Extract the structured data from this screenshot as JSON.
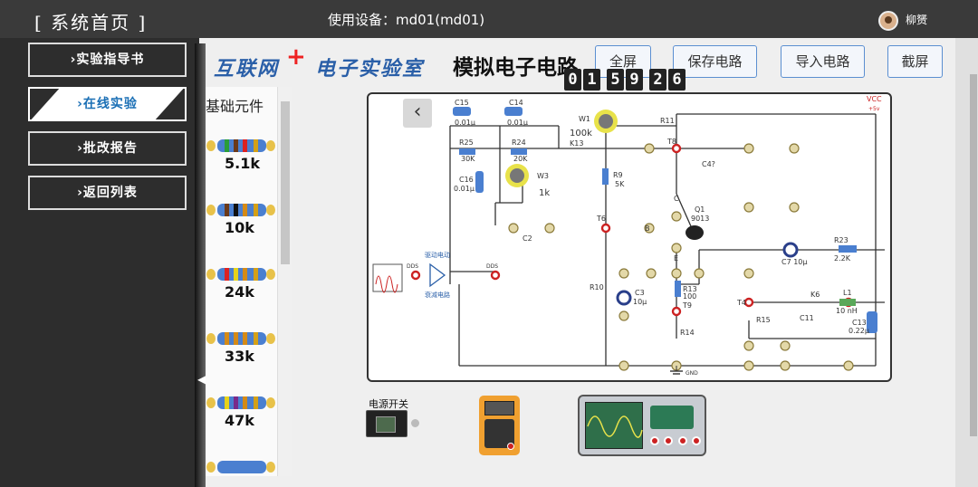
{
  "header": {
    "title": "[ 系统首页 ]",
    "device_label": "使用设备：md01(md01)",
    "username": "柳赟"
  },
  "nav": {
    "items": [
      {
        "label": "›实验指导书"
      },
      {
        "label": "›在线实验"
      },
      {
        "label": "›批改报告"
      },
      {
        "label": "›返回列表"
      }
    ]
  },
  "brand": {
    "part1": "互联网",
    "plus": "+",
    "part2": "电子实验室"
  },
  "circuit_title": "模拟电子电路",
  "toolbar": {
    "fullscreen": "全屏",
    "save": "保存电路",
    "import": "导入电路",
    "screenshot": "截屏"
  },
  "timer": {
    "digits": [
      "0",
      "1",
      "5",
      "9",
      "2",
      "6"
    ]
  },
  "components": {
    "heading": "基础元件",
    "resistors": [
      {
        "label": "5.1k"
      },
      {
        "label": "10k"
      },
      {
        "label": "24k"
      },
      {
        "label": "33k"
      },
      {
        "label": "47k"
      }
    ]
  },
  "circuit": {
    "labels": {
      "c15": "C15",
      "c15v": "0.01μ",
      "c14": "C14",
      "c14v": "0.01μ",
      "w1": "W1",
      "w1v": "100k",
      "r11": "R11",
      "k13": "K13",
      "r25": "R25",
      "r25v": "30K",
      "r24": "R24",
      "r24v": "20K",
      "c16": "C16",
      "c16v": "0.01μ",
      "w3": "W3",
      "w3v": "1k",
      "r9": "R9",
      "r9v": "5K",
      "t8": "T8",
      "c4": "C4?",
      "vcc": "VCC",
      "vccv": "+5v",
      "c": "C",
      "q1": "Q1",
      "q1v": "9013",
      "b": "B",
      "e": "E",
      "t6": "T6",
      "c2": "C2",
      "osc_label": "驱动电动",
      "diag_label": "衰减电路",
      "ddsl": "DDS",
      "ddsr": "DDS",
      "c7": "C7 10μ",
      "r23": "R23",
      "r23v": "2.2K",
      "r10": "R10",
      "c3": "C3",
      "c3v": "10μ",
      "r13": "R13",
      "r13v": "100",
      "t9": "T9",
      "t4": "T4",
      "k6": "K6",
      "l1": "L1",
      "l1v": "10 nH",
      "r15": "R15",
      "c11": "C11",
      "c13": "C13",
      "c13v": "0.22μ",
      "r14": "R14",
      "gnd": "GND"
    }
  },
  "instruments": {
    "power_switch": "电源开关"
  }
}
